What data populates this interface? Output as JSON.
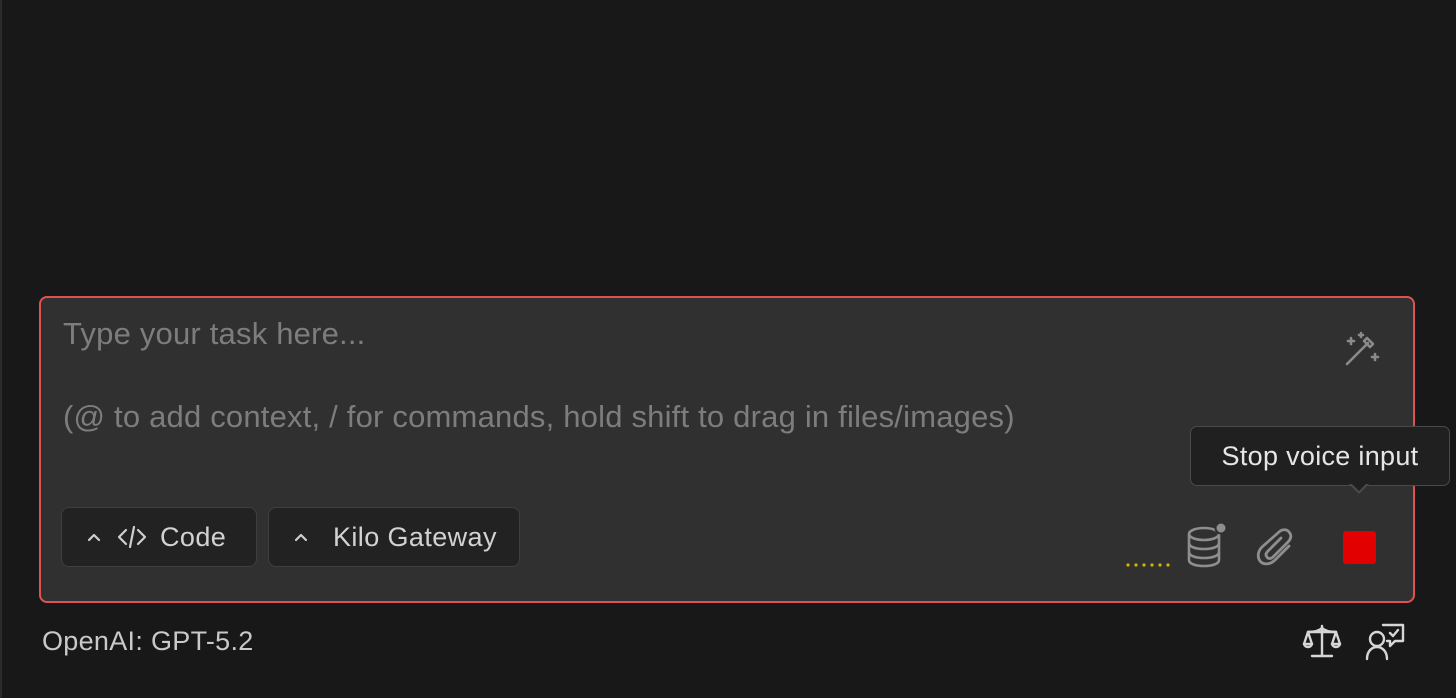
{
  "composer": {
    "placeholder_line1": "Type your task here...",
    "placeholder_line2": "(@ to add context, / for commands, hold shift to drag in files/images)",
    "enhance_icon": "magic-wand-icon",
    "mode_selector": {
      "icon": "chevron-up-icon",
      "mode_icon": "code-icon",
      "label": "Code"
    },
    "provider_selector": {
      "icon": "chevron-up-icon",
      "label": "Kilo Gateway"
    },
    "actions": {
      "context_icon": "database-icon",
      "attach_icon": "paperclip-icon",
      "stop_icon": "stop-square-icon"
    },
    "border_color": "#e05252",
    "stop_color": "#e30000"
  },
  "tooltip": {
    "text": "Stop voice input"
  },
  "footer": {
    "model_label": "OpenAI: GPT-5.2",
    "icons": [
      "scales-icon",
      "feedback-icon"
    ]
  }
}
